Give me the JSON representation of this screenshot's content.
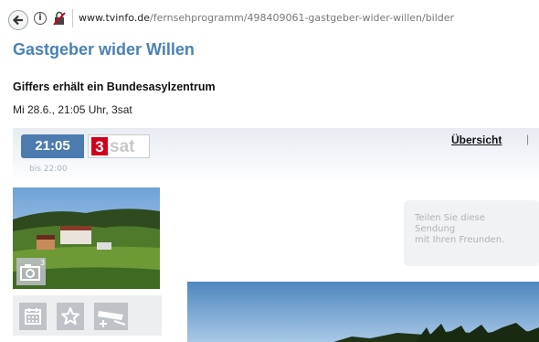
{
  "browser": {
    "url_domain": "www.tvinfo.de",
    "url_path": "/fernsehprogramm/498409061-gastgeber-wider-willen/bilder"
  },
  "page": {
    "title": "Gastgeber wider Willen",
    "episode_title": "Giffers erhält ein Bundesasylzentrum",
    "airtime": "Mi 28.6., 21:05 Uhr, 3sat"
  },
  "program": {
    "start_time": "21:05",
    "channel_logo": {
      "number": "3",
      "name": "sat"
    },
    "end_time": "bis 22:00",
    "overview_label": "Übersicht",
    "separator": "|"
  },
  "share": {
    "lines": [
      "Teilen Sie diese",
      "Sendung",
      "mit Ihren Freunden."
    ]
  },
  "icons": {
    "back": "arrow-left-icon",
    "info": "info-icon",
    "lock": "insecure-lock-icon",
    "camera": "camera-icon",
    "calendar": "calendar-icon",
    "star": "star-icon",
    "remote": "remote-icon"
  },
  "colors": {
    "title_blue": "#4a82b4",
    "time_badge": "#4c7bb0",
    "channel_red": "#d0021b"
  }
}
